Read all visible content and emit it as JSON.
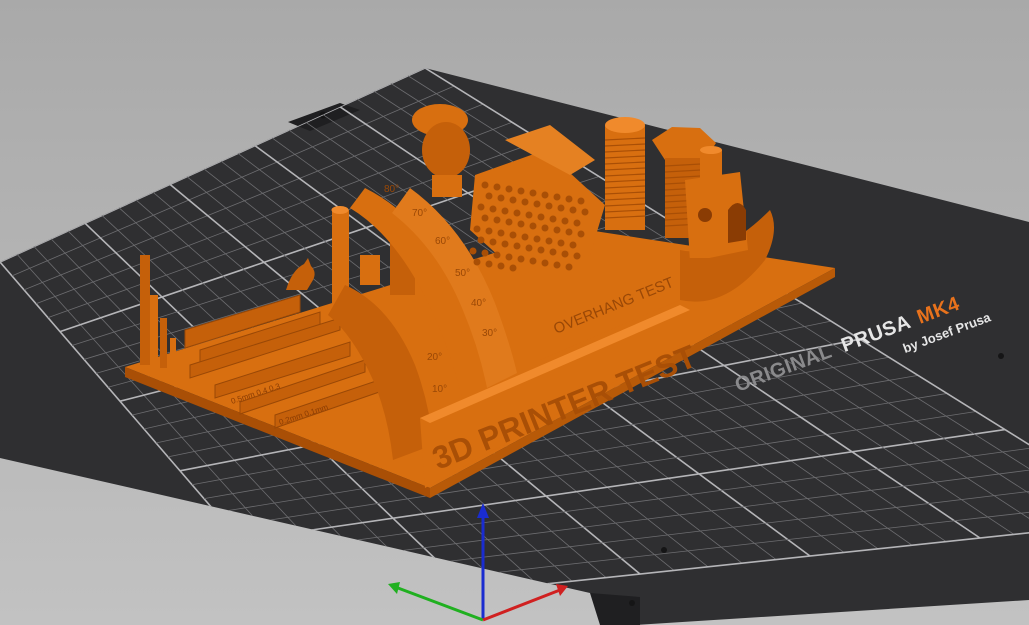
{
  "viewport": {
    "background_top": "#a9a9a9",
    "background_bottom": "#c2c2c2"
  },
  "bed": {
    "surface_color": "#2f2f31",
    "edge_color": "#1f1f21",
    "grid_minor_color": "#6d6d70",
    "grid_major_color": "#b5b5b8",
    "brand_line1_prefix": "ORIGINAL",
    "brand_line1_name": "PRUSA",
    "brand_line1_model": "MK4",
    "brand_line2": "by Josef Prusa",
    "brand_orange": "#e8721c",
    "brand_gray": "#8a8a8c",
    "brand_white": "#e6e6e6"
  },
  "model": {
    "color": "#d86f10",
    "shade_color": "#a94f06",
    "highlight_color": "#f08a2c",
    "main_label": "3D PRINTER TEST",
    "overhang_label": "OVERHANG TEST",
    "angle_labels": [
      "80°",
      "70°",
      "60°",
      "50°",
      "40°",
      "30°",
      "20°",
      "10°"
    ]
  },
  "axes": {
    "x_color": "#d02020",
    "y_color": "#20b020",
    "z_color": "#1a2cd0"
  }
}
